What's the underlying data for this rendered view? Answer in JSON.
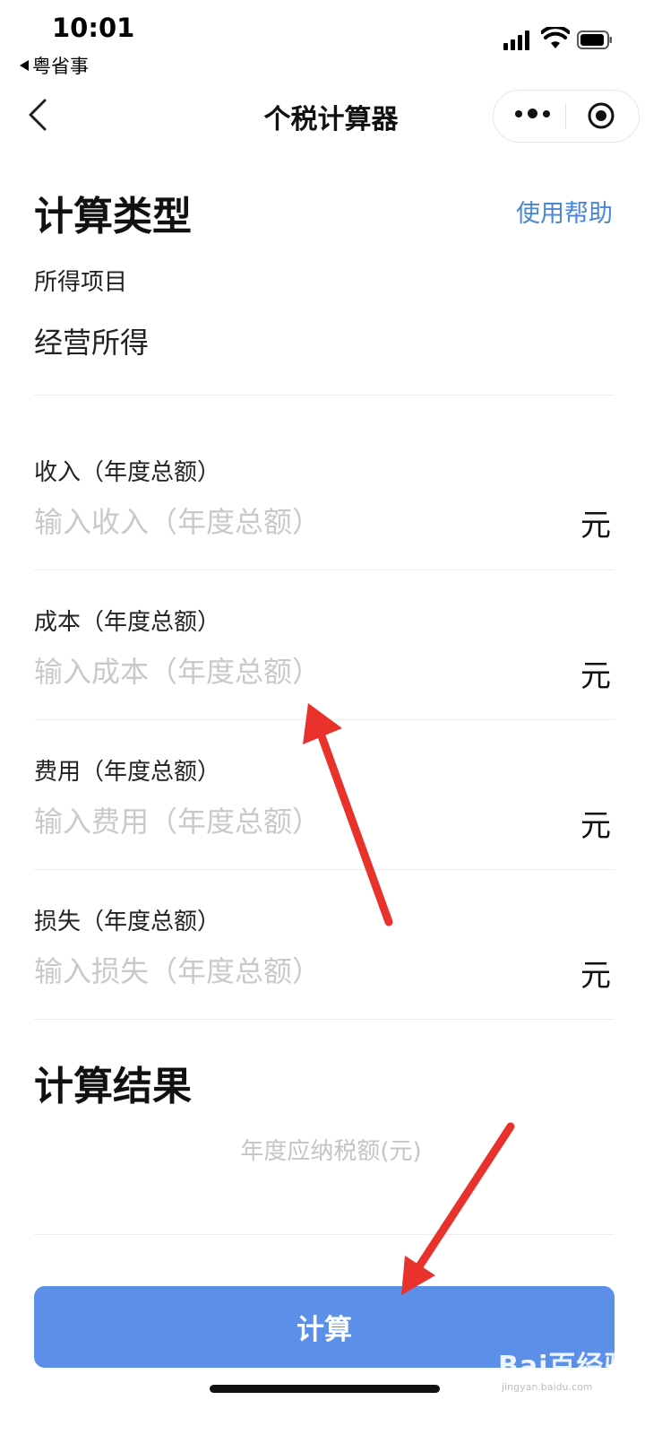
{
  "status_bar": {
    "time": "10:01",
    "back_app": "粤省事"
  },
  "nav": {
    "title": "个税计算器"
  },
  "calc_type": {
    "title": "计算类型",
    "help_link": "使用帮助",
    "item_label": "所得项目",
    "item_value": "经营所得"
  },
  "fields": [
    {
      "label": "收入（年度总额）",
      "placeholder": "输入收入（年度总额）",
      "unit": "元"
    },
    {
      "label": "成本（年度总额）",
      "placeholder": "输入成本（年度总额）",
      "unit": "元"
    },
    {
      "label": "费用（年度总额）",
      "placeholder": "输入费用（年度总额）",
      "unit": "元"
    },
    {
      "label": "损失（年度总额）",
      "placeholder": "输入损失（年度总额）",
      "unit": "元"
    }
  ],
  "result": {
    "title": "计算结果",
    "placeholder": "年度应纳税额(元)"
  },
  "calculate_button": "计算",
  "watermark": {
    "logo_text": "Bai百经验",
    "url": "jingyan.baidu.com"
  },
  "colors": {
    "accent": "#4a86d8",
    "button": "#5b8fe8",
    "arrow": "#e8322b"
  }
}
